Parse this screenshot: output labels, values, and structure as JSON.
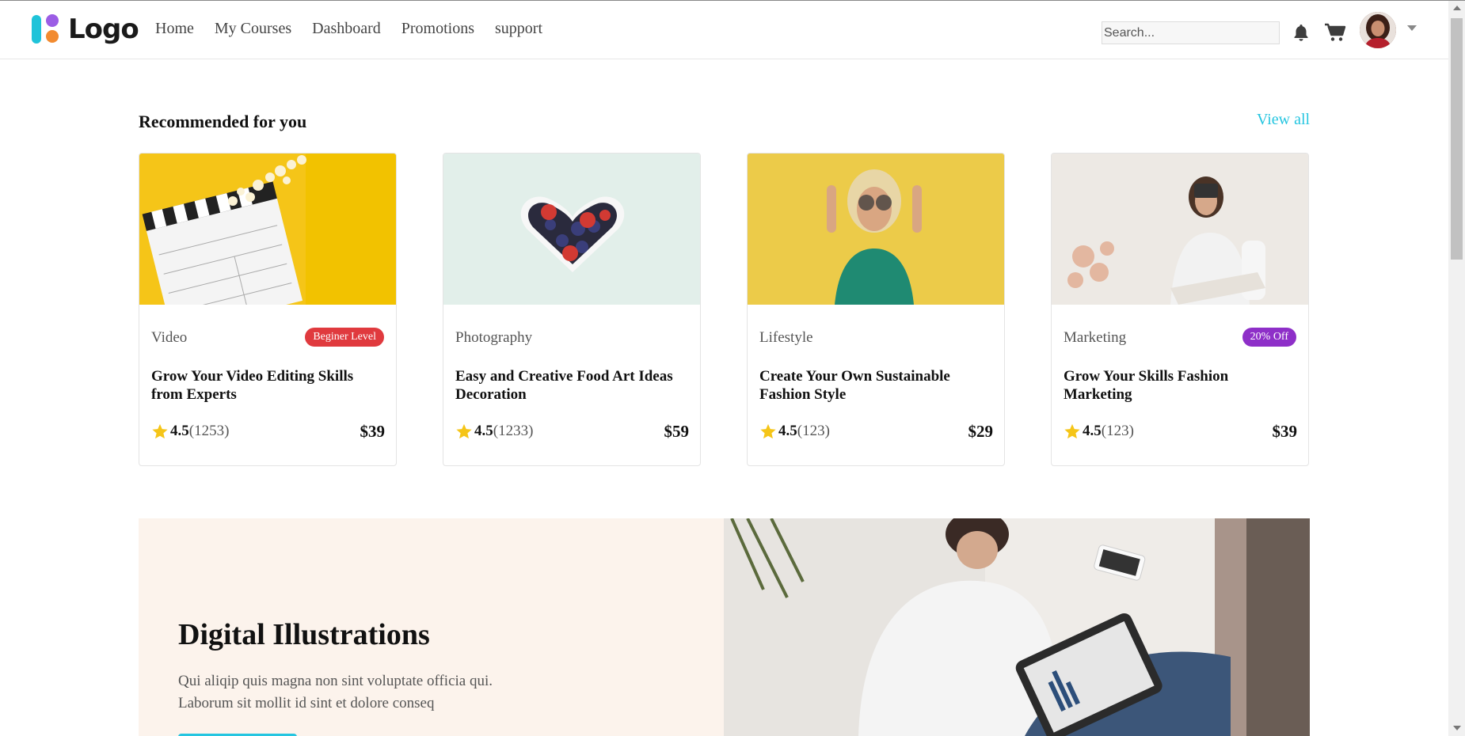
{
  "header": {
    "logo_text": "Logo",
    "nav": [
      "Home",
      "My Courses",
      "Dashboard",
      "Promotions",
      "support"
    ],
    "search_placeholder": "Search...",
    "icons": [
      "bell-icon",
      "cart-icon",
      "avatar",
      "chevron-down-icon"
    ]
  },
  "recommended": {
    "title": "Recommended for you",
    "view_all": "View all",
    "cards": [
      {
        "category": "Video",
        "badge": "Beginer Level",
        "badge_color": "#e03a3e",
        "title": "Grow Your Video Editing Skills from Experts",
        "rating": "4.5",
        "count": "(1253)",
        "price": "$39"
      },
      {
        "category": "Photography",
        "badge": "",
        "title": "Easy and Creative Food Art Ideas Decoration",
        "rating": "4.5",
        "count": "(1233)",
        "price": "$59"
      },
      {
        "category": "Lifestyle",
        "badge": "",
        "title": "Create Your Own Sustainable Fashion Style",
        "rating": "4.5",
        "count": "(123)",
        "price": "$29"
      },
      {
        "category": "Marketing",
        "badge": "20% Off",
        "badge_color": "#8e2fc8",
        "title": "Grow Your Skills Fashion Marketing",
        "rating": "4.5",
        "count": "(123)",
        "price": "$39"
      }
    ]
  },
  "hero": {
    "title": "Digital Illustrations",
    "text": "Qui aliqip quis magna non sint voluptate officia qui. Laborum sit mollit id sint et dolore conseq"
  },
  "colors": {
    "accent": "#25c5e0",
    "hero_bg": "#fcf3ec",
    "star": "#f5c518"
  }
}
